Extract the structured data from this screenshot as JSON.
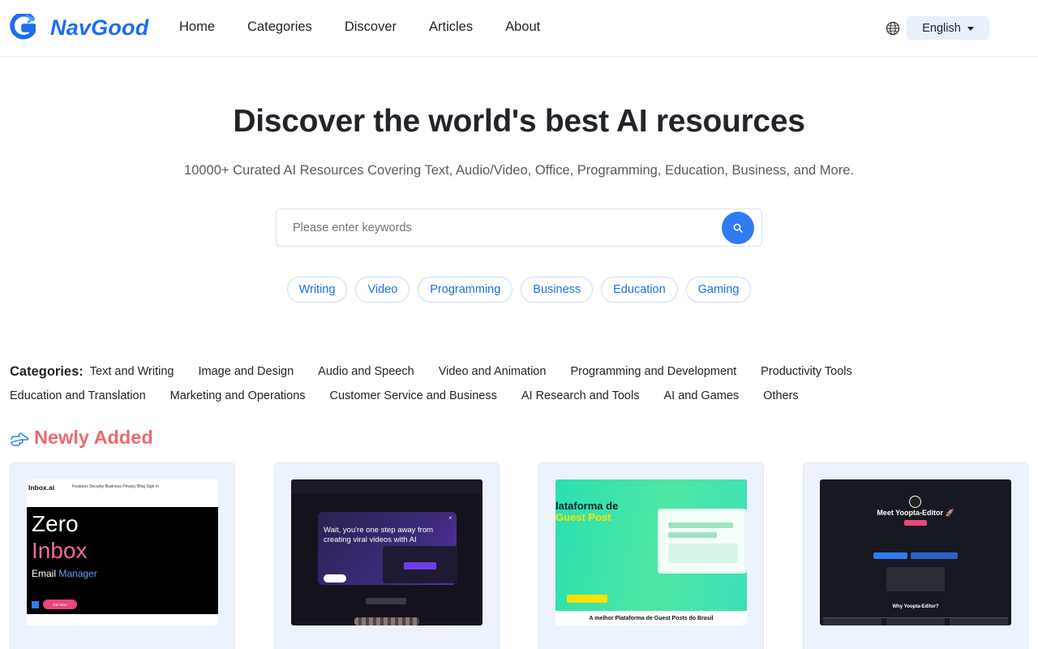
{
  "header": {
    "logo_text": "NavGood",
    "nav": [
      "Home",
      "Categories",
      "Discover",
      "Articles",
      "About"
    ],
    "language": "English"
  },
  "hero": {
    "title": "Discover the world's best AI resources",
    "subtitle": "10000+ Curated AI Resources Covering Text, Audio/Video, Office, Programming, Education, Business, and More.",
    "search_placeholder": "Please enter keywords",
    "tags": [
      "Writing",
      "Video",
      "Programming",
      "Business",
      "Education",
      "Gaming"
    ]
  },
  "categories": {
    "label": "Categories:",
    "row1": [
      "Text and Writing",
      "Image and Design",
      "Audio and Speech",
      "Video and Animation",
      "Programming and Development",
      "Productivity Tools"
    ],
    "row2": [
      "Education and Translation",
      "Marketing and Operations",
      "Customer Service and Business",
      "AI Research and Tools",
      "AI and Games",
      "Others"
    ]
  },
  "newly_added": {
    "title": "Newly Added",
    "cards": [
      {
        "brand": "Inbox.ai",
        "nav": "Features  Security  Business  Privacy  Blog      Sign In",
        "line1": "Zero",
        "line2": "Inbox",
        "line3a": "Email",
        "line3b": "Manager",
        "cta": "Get Now"
      },
      {
        "headline": "Wait, you're one step away from creating viral videos with AI",
        "close": "×"
      },
      {
        "title1": "lataforma de",
        "title2": "Guest Post",
        "footer": "A melhor Plataforma de Guest Posts do Brasil"
      },
      {
        "heading": "Meet Yoopta-Editor 🚀",
        "subheading": "Why Yoopta-Editor?"
      }
    ]
  },
  "colors": {
    "brand_blue": "#1a6cf2",
    "accent_red": "#ec6a6a",
    "search_button": "#2f7bf1"
  },
  "icons": {
    "globe": "globe-icon",
    "search": "search-icon",
    "hand": "pointing-hand-icon"
  }
}
